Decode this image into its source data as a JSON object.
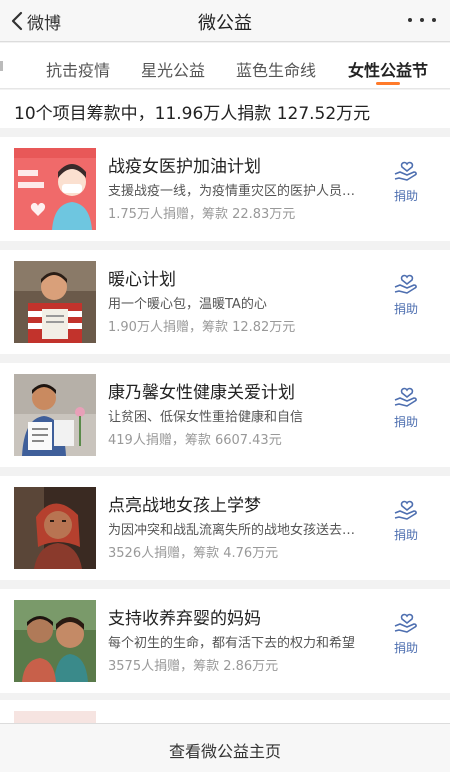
{
  "nav": {
    "back_label": "微博",
    "title": "微公益"
  },
  "tabs": [
    {
      "label": "抗击疫情",
      "active": false
    },
    {
      "label": "星光公益",
      "active": false
    },
    {
      "label": "蓝色生命线",
      "active": false
    },
    {
      "label": "女性公益节",
      "active": true
    }
  ],
  "summary": "10个项目筹款中，11.96万人捐款 127.52万元",
  "projects": [
    {
      "title": "战疫女医护加油计划",
      "desc": "支援战疫一线，为疫情重灾区的医护人员送去关爱",
      "stats": "1.75万人捐赠，筹款 22.83万元",
      "donate_label": "捐助"
    },
    {
      "title": "暖心计划",
      "desc": "用一个暖心包，温暖TA的心",
      "stats": "1.90万人捐赠，筹款 12.82万元",
      "donate_label": "捐助"
    },
    {
      "title": "康乃馨女性健康关爱计划",
      "desc": "让贫困、低保女性重拾健康和自信",
      "stats": "419人捐赠，筹款 6607.43元",
      "donate_label": "捐助"
    },
    {
      "title": "点亮战地女孩上学梦",
      "desc": "为因冲突和战乱流离失所的战地女孩送去上学的希望",
      "stats": "3526人捐赠，筹款 4.76万元",
      "donate_label": "捐助"
    },
    {
      "title": "支持收养弃婴的妈妈",
      "desc": "每个初生的生命，都有活下去的权力和希望",
      "stats": "3575人捐赠，筹款 2.86万元",
      "donate_label": "捐助"
    }
  ],
  "footer_label": "查看微公益主页",
  "colors": {
    "accent": "#ff7a2a",
    "donate": "#4e6fb0",
    "poster": "#f06a6a"
  }
}
